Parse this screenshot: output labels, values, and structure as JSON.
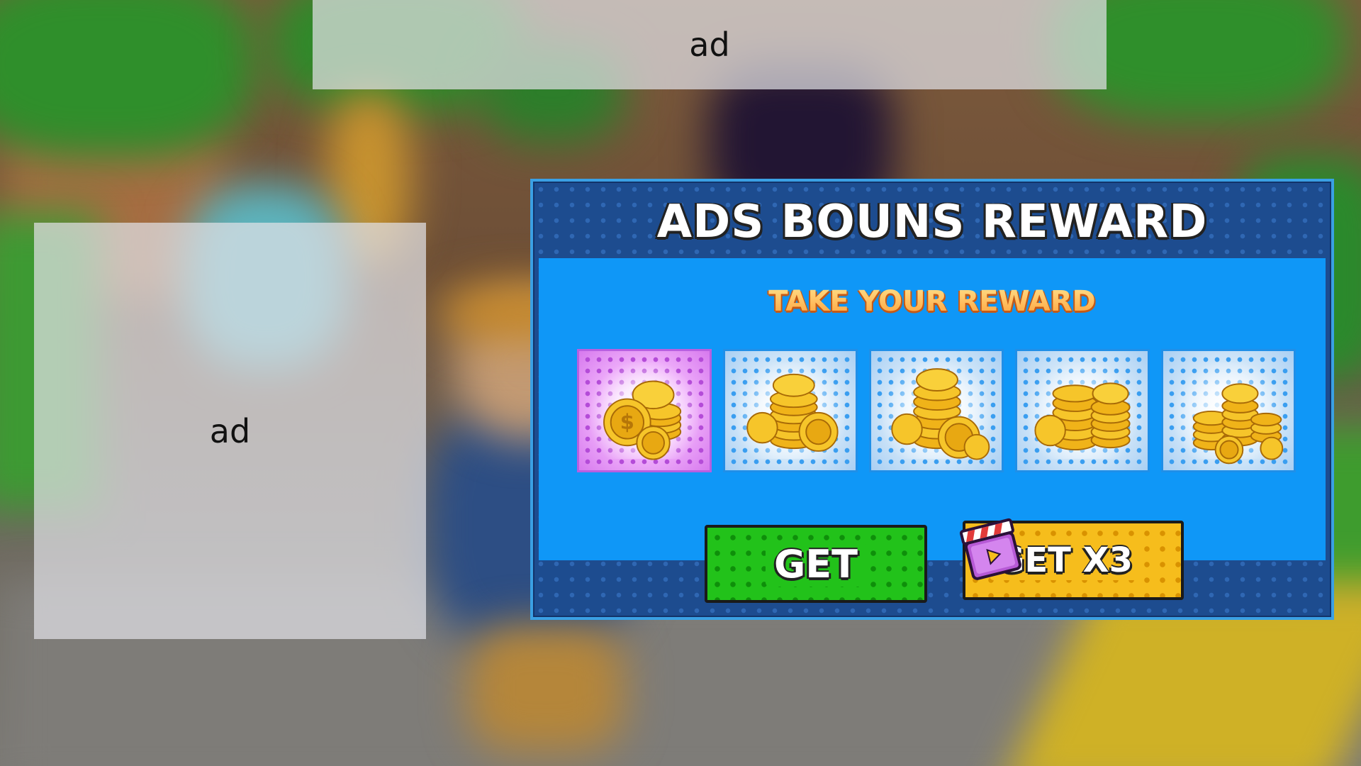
{
  "ads": {
    "top_label": "ad",
    "left_label": "ad"
  },
  "reward_panel": {
    "title": "ADS BOUNS REWARD",
    "subtitle": "TAKE YOUR REWARD",
    "items": [
      {
        "icon": "coin-stack-icon",
        "selected": true
      },
      {
        "icon": "coin-stack-icon",
        "selected": false
      },
      {
        "icon": "coin-stack-icon",
        "selected": false
      },
      {
        "icon": "coin-stack-icon",
        "selected": false
      },
      {
        "icon": "coin-stack-icon",
        "selected": false
      }
    ],
    "buttons": {
      "get_label": "GET",
      "get_x3_label": "GET X3",
      "get_x3_icon": "video-clapper-icon"
    }
  },
  "colors": {
    "panel_frame": "#1d4c8f",
    "panel_inner": "#0f97f7",
    "selected_slot": "#e7a6f5",
    "get_button": "#22c21a",
    "get_x3_button": "#f6bd1c",
    "subtitle": "#ffa13a"
  }
}
